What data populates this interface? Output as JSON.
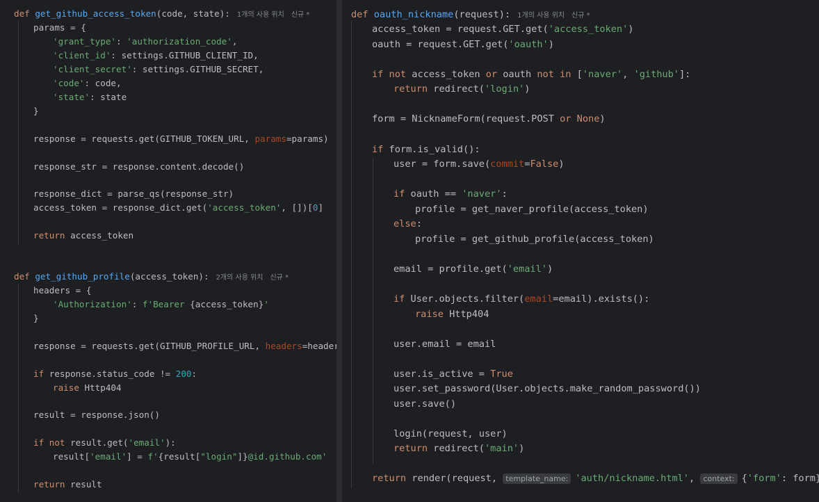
{
  "left": {
    "hint_func1": "1개의 사용 위치",
    "hint_func1_new": "신규 *",
    "hint_func2": "2개의 사용 위치",
    "hint_func2_new": "신규 *",
    "code": [
      "def get_github_access_token(code, state):",
      "    params = {",
      "        'grant_type': 'authorization_code',",
      "        'client_id': settings.GITHUB_CLIENT_ID,",
      "        'client_secret': settings.GITHUB_SECRET,",
      "        'code': code,",
      "        'state': state",
      "    }",
      "    response = requests.get(GITHUB_TOKEN_URL, params=params)",
      "    response_str = response.content.decode()",
      "    response_dict = parse_qs(response_str)",
      "    access_token = response_dict.get('access_token', [])[0]",
      "    return access_token",
      "def get_github_profile(access_token):",
      "    headers = {",
      "        'Authorization': f'Bearer {access_token}'",
      "    }",
      "    response = requests.get(GITHUB_PROFILE_URL, headers=headers)",
      "    if response.status_code != 200:",
      "        raise Http404",
      "    result = response.json()",
      "    if not result.get('email'):",
      "        result['email'] = f'{result[\"login\"]}@id.github.com'",
      "    return result"
    ]
  },
  "right": {
    "hint_func": "1개의 사용 위치",
    "hint_func_new": "신규 *",
    "inlay_template_name": "template_name:",
    "inlay_context": "context:",
    "code": [
      "def oauth_nickname(request):",
      "    access_token = request.GET.get('access_token')",
      "    oauth = request.GET.get('oauth')",
      "    if not access_token or oauth not in ['naver', 'github']:",
      "        return redirect('login')",
      "    form = NicknameForm(request.POST or None)",
      "    if form.is_valid():",
      "        user = form.save(commit=False)",
      "        if oauth == 'naver':",
      "            profile = get_naver_profile(access_token)",
      "        else:",
      "            profile = get_github_profile(access_token)",
      "        email = profile.get('email')",
      "        if User.objects.filter(email=email).exists():",
      "            raise Http404",
      "        user.email = email",
      "        user.is_active = True",
      "        user.set_password(User.objects.make_random_password())",
      "        user.save()",
      "        login(request, user)",
      "        return redirect('main')",
      "    return render(request, 'auth/nickname.html', {'form': form})"
    ]
  }
}
